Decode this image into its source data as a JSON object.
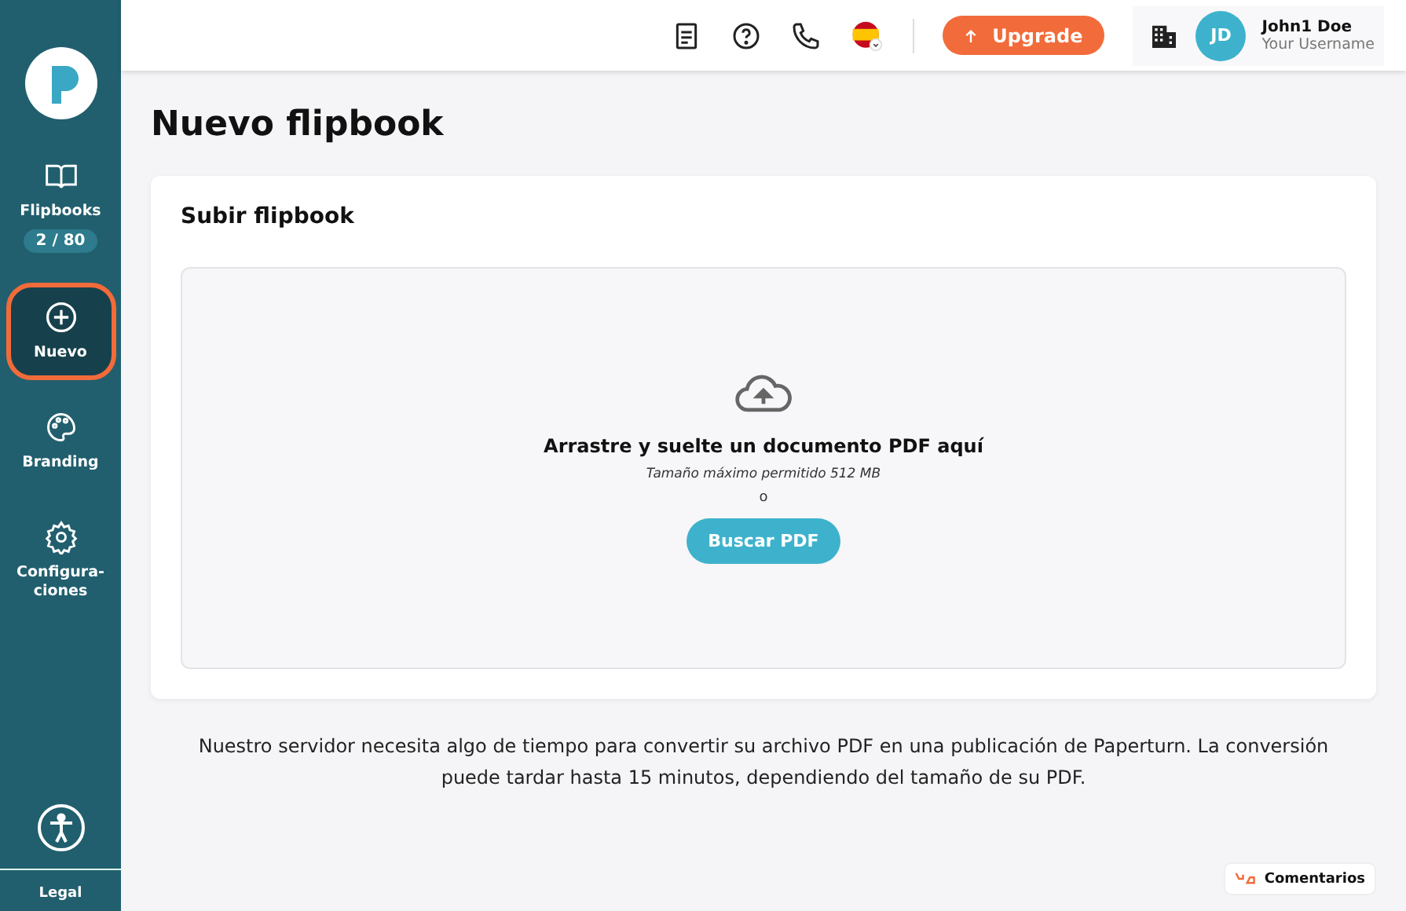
{
  "sidebar": {
    "items": [
      {
        "kind": "book",
        "label": "Flipbooks",
        "badge": "2 / 80",
        "selected": false
      },
      {
        "kind": "plus",
        "label": "Nuevo",
        "selected": true
      },
      {
        "kind": "palette",
        "label": "Branding",
        "selected": false
      },
      {
        "kind": "gear",
        "label": "Configura-\nciones",
        "selected": false
      }
    ],
    "footer": "Legal"
  },
  "header": {
    "upgrade": "Upgrade",
    "user": {
      "initials": "JD",
      "name": "John1 Doe",
      "username": "Your Username"
    }
  },
  "page": {
    "title": "Nuevo flipbook",
    "card_title": "Subir flipbook",
    "dropzone": {
      "heading": "Arrastre y suelte un documento PDF aquí",
      "hint": "Tamaño máximo permitido 512 MB",
      "or": "o",
      "button": "Buscar PDF"
    },
    "note": "Nuestro servidor necesita algo de tiempo para convertir su archivo PDF en una publicación de Paperturn. La conversión puede tardar hasta 15 minutos, dependiendo del tamaño de su PDF."
  },
  "feedback": "Comentarios"
}
